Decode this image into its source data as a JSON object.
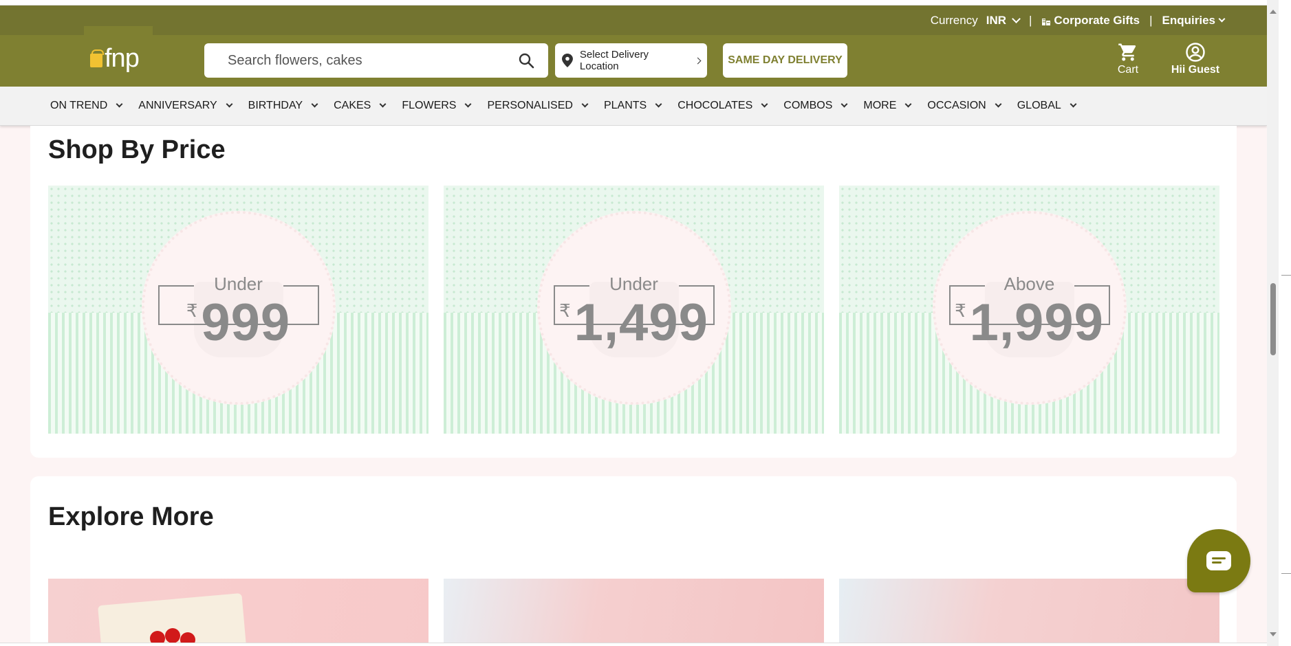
{
  "topbar": {
    "currency_label": "Currency",
    "currency_value": "INR",
    "separator": "|",
    "corporate_gifts": "Corporate Gifts",
    "enquiries": "Enquiries"
  },
  "header": {
    "logo_text": "fnp",
    "search_placeholder": "Search flowers, cakes",
    "location": "Select Delivery Location",
    "same_day": "SAME DAY DELIVERY",
    "cart_label": "Cart",
    "guest_label": "Hii Guest"
  },
  "nav": {
    "items": [
      "ON TREND",
      "ANNIVERSARY",
      "BIRTHDAY",
      "CAKES",
      "FLOWERS",
      "PERSONALISED",
      "PLANTS",
      "CHOCOLATES",
      "COMBOS",
      "MORE",
      "OCCASION",
      "GLOBAL"
    ]
  },
  "shop_by_price": {
    "title": "Shop By Price",
    "cards": [
      {
        "label": "Under",
        "currency": "₹",
        "amount": "999"
      },
      {
        "label": "Under",
        "currency": "₹",
        "amount": "1,499"
      },
      {
        "label": "Above",
        "currency": "₹",
        "amount": "1,999"
      }
    ]
  },
  "explore_more": {
    "title": "Explore More"
  },
  "colors": {
    "header_dark": "#737430",
    "header": "#7f8031",
    "nav_bg": "#f2f2f2",
    "chat_button": "#7b7a12"
  },
  "icons": [
    "gift-logo-icon",
    "building-icon",
    "search-icon",
    "location-pin-icon",
    "cart-icon",
    "user-icon",
    "chat-icon"
  ]
}
